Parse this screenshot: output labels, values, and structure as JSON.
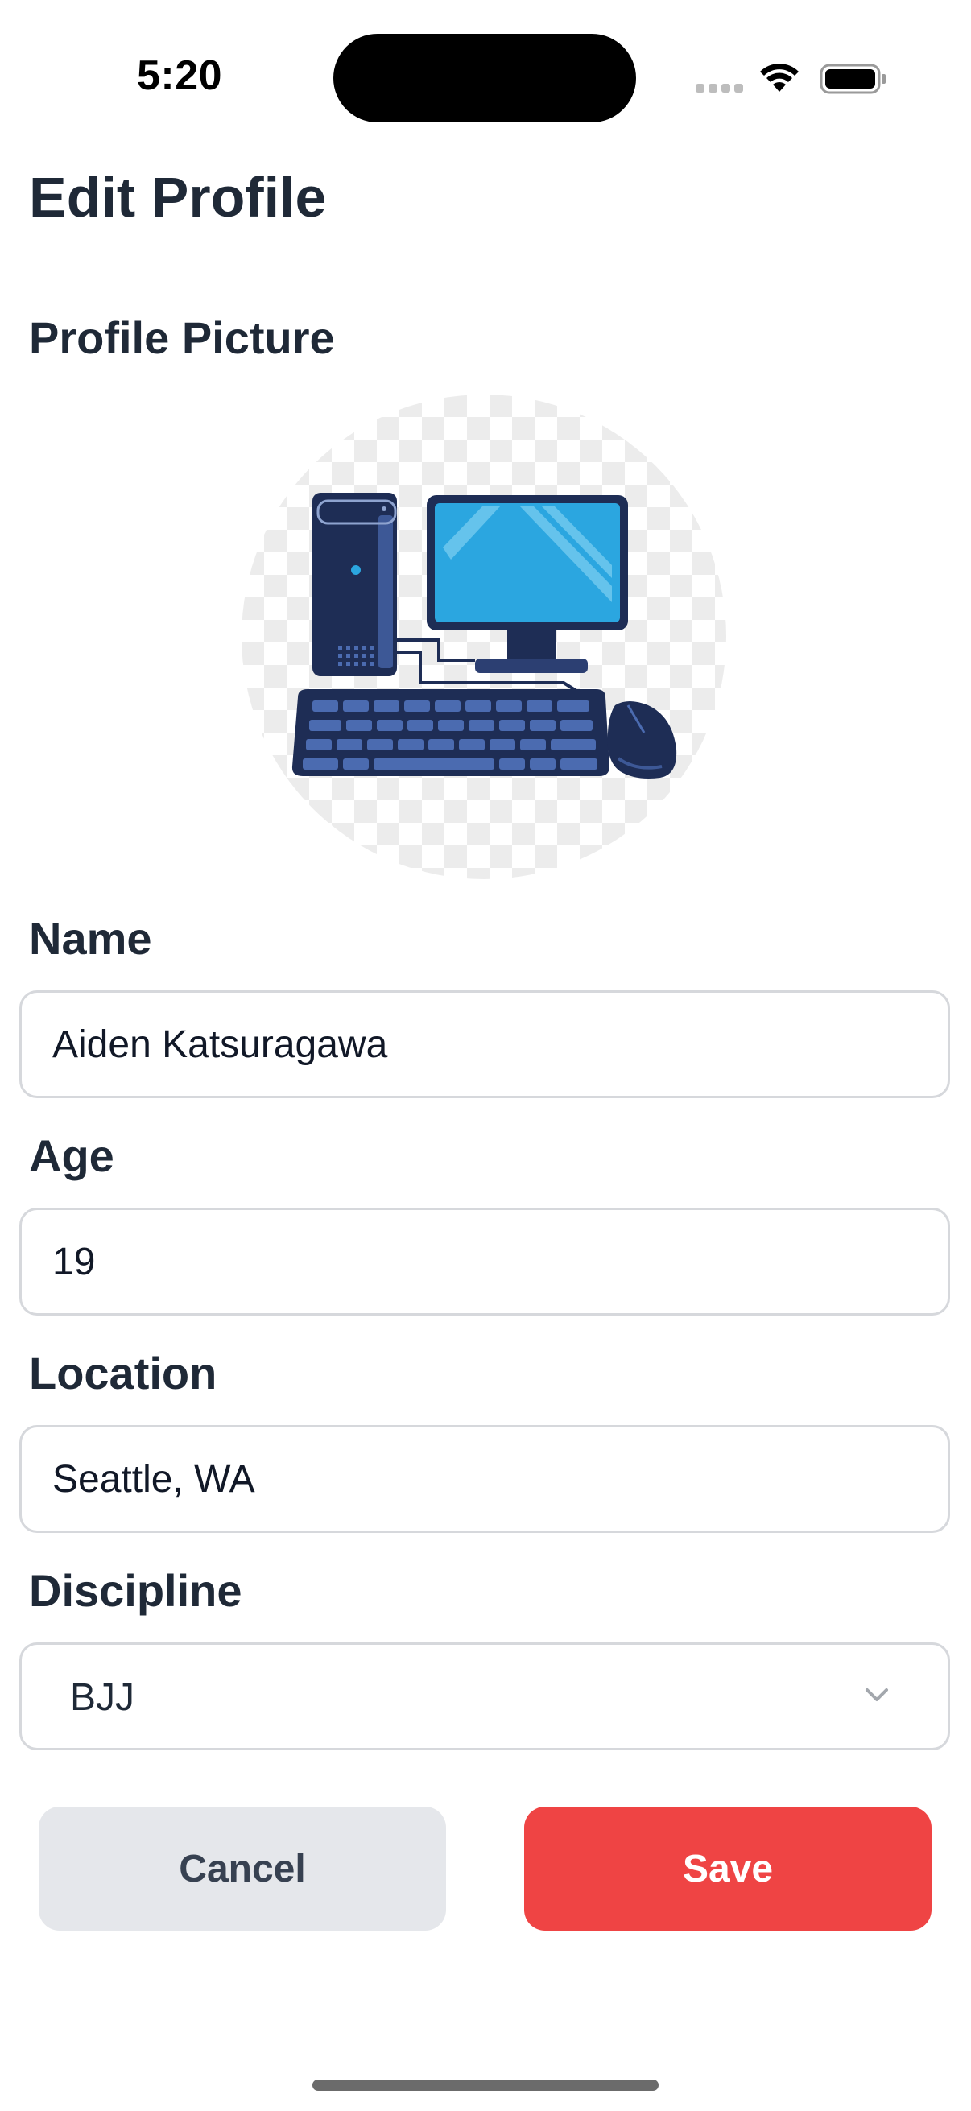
{
  "status_bar": {
    "time": "5:20",
    "icons": [
      "cellular-signal-icon",
      "wifi-icon",
      "battery-icon"
    ]
  },
  "header": {
    "title": "Edit Profile"
  },
  "profile_picture": {
    "label": "Profile Picture",
    "image": "desktop-computer-illustration"
  },
  "form": {
    "name": {
      "label": "Name",
      "value": "Aiden Katsuragawa"
    },
    "age": {
      "label": "Age",
      "value": "19"
    },
    "location": {
      "label": "Location",
      "value": "Seattle, WA"
    },
    "discipline": {
      "label": "Discipline",
      "value": "BJJ",
      "icon": "chevron-down-icon"
    }
  },
  "actions": {
    "cancel_label": "Cancel",
    "save_label": "Save"
  },
  "colors": {
    "text_primary": "#1f2937",
    "input_border": "#d6d8dc",
    "cancel_bg": "#e5e7eb",
    "save_bg": "#ef4444",
    "save_text": "#ffffff"
  }
}
